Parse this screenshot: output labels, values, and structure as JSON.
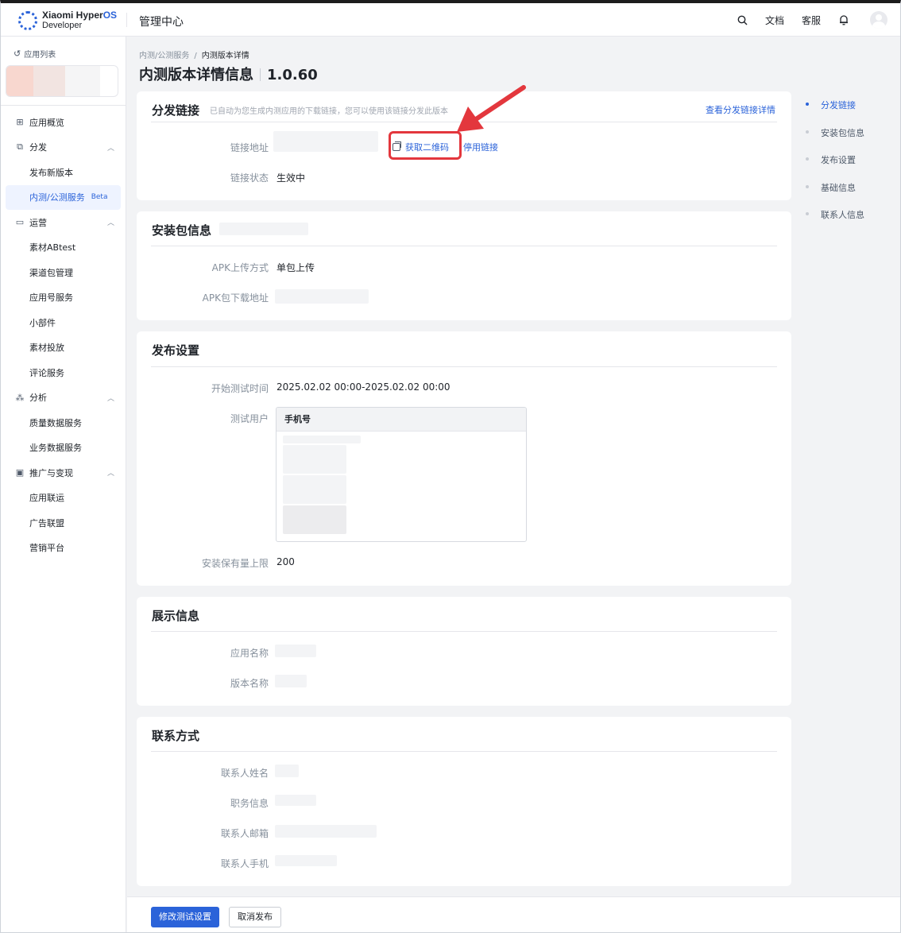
{
  "header": {
    "brand": "Xiaomi Hyper",
    "brand_os": "OS",
    "brand_sub": "Developer",
    "console_title": "管理中心",
    "docs": "文档",
    "support": "客服"
  },
  "sidebar": {
    "back_label": "应用列表",
    "items": [
      {
        "label": "应用概览",
        "type": "group",
        "icon": "grid-icon"
      },
      {
        "label": "分发",
        "type": "group",
        "icon": "share-icon",
        "expanded": true
      },
      {
        "label": "发布新版本",
        "type": "sub"
      },
      {
        "label": "内测/公测服务",
        "type": "sub",
        "active": true,
        "badge": "Beta"
      },
      {
        "label": "运营",
        "type": "group",
        "icon": "monitor-icon",
        "expanded": true
      },
      {
        "label": "素材ABtest",
        "type": "sub"
      },
      {
        "label": "渠道包管理",
        "type": "sub"
      },
      {
        "label": "应用号服务",
        "type": "sub"
      },
      {
        "label": "小部件",
        "type": "sub"
      },
      {
        "label": "素材投放",
        "type": "sub"
      },
      {
        "label": "评论服务",
        "type": "sub"
      },
      {
        "label": "分析",
        "type": "group",
        "icon": "chart-icon",
        "expanded": true
      },
      {
        "label": "质量数据服务",
        "type": "sub"
      },
      {
        "label": "业务数据服务",
        "type": "sub"
      },
      {
        "label": "推广与变现",
        "type": "group",
        "icon": "promo-icon",
        "expanded": true
      },
      {
        "label": "应用联运",
        "type": "sub"
      },
      {
        "label": "广告联盟",
        "type": "sub"
      },
      {
        "label": "营销平台",
        "type": "sub"
      }
    ]
  },
  "breadcrumb": {
    "parent": "内测/公测服务",
    "separator": "/",
    "current": "内测版本详情"
  },
  "page": {
    "title": "内测版本详情信息",
    "version": "1.0.60"
  },
  "distribution": {
    "title": "分发链接",
    "hint": "已自动为您生成内测应用的下载链接，您可以使用该链接分发此版本",
    "detail_link": "查看分发链接详情",
    "link_label": "链接地址",
    "qr_button": "获取二维码",
    "stop_link": "停用链接",
    "status_label": "链接状态",
    "status_value": "生效中"
  },
  "package": {
    "title": "安装包信息",
    "upload_label": "APK上传方式",
    "upload_value": "单包上传",
    "download_label": "APK包下载地址"
  },
  "publish": {
    "title": "发布设置",
    "time_label": "开始测试时间",
    "time_value": "2025.02.02 00:00-2025.02.02 00:00",
    "users_label": "测试用户",
    "users_column": "手机号",
    "limit_label": "安装保有量上限",
    "limit_value": "200"
  },
  "display": {
    "title": "展示信息",
    "app_name_label": "应用名称",
    "version_name_label": "版本名称"
  },
  "contact": {
    "title": "联系方式",
    "name_label": "联系人姓名",
    "position_label": "职务信息",
    "email_label": "联系人邮箱",
    "phone_label": "联系人手机"
  },
  "anchor": [
    "分发链接",
    "安装包信息",
    "发布设置",
    "基础信息",
    "联系人信息"
  ],
  "footer": {
    "modify_button": "修改测试设置",
    "cancel_button": "取消发布"
  },
  "colors": {
    "accent": "#2b63d9",
    "highlight": "#e3373d"
  }
}
